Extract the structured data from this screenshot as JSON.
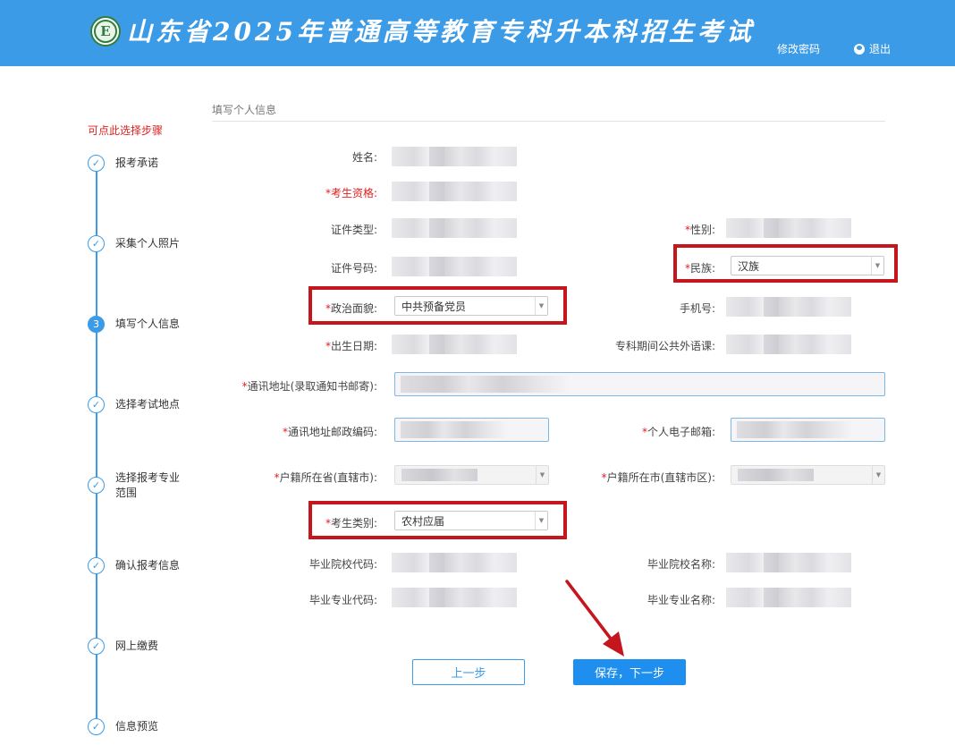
{
  "header": {
    "title": "山东省2025年普通高等教育专科升本科招生考试",
    "logo_text": "E",
    "change_password": "修改密码",
    "logout": "退出"
  },
  "sidebar": {
    "hint": "可点此选择步骤",
    "steps": [
      {
        "label": "报考承诺",
        "marker": "✓"
      },
      {
        "label": "采集个人照片",
        "marker": "✓"
      },
      {
        "label": "填写个人信息",
        "marker": "3"
      },
      {
        "label": "选择考试地点",
        "marker": "✓"
      },
      {
        "label": "选择报考专业范围",
        "marker": "✓"
      },
      {
        "label": "确认报考信息",
        "marker": "✓"
      },
      {
        "label": "网上缴费",
        "marker": "✓"
      },
      {
        "label": "信息预览",
        "marker": "✓"
      }
    ]
  },
  "form": {
    "section_title": "填写个人信息",
    "labels": {
      "name": "姓名:",
      "qualification": "考生资格:",
      "id_type": "证件类型:",
      "gender": "性别:",
      "id_number": "证件号码:",
      "ethnicity": "民族:",
      "political": "政治面貌:",
      "phone": "手机号:",
      "birth_date": "出生日期:",
      "foreign_lang": "专科期间公共外语课:",
      "address": "通讯地址(录取通知书邮寄):",
      "postcode": "通讯地址邮政编码:",
      "email": "个人电子邮箱:",
      "province": "户籍所在省(直辖市):",
      "city": "户籍所在市(直辖市区):",
      "category": "考生类别:",
      "school_code": "毕业院校代码:",
      "school_name": "毕业院校名称:",
      "major_code": "毕业专业代码:",
      "major_name": "毕业专业名称:"
    },
    "values": {
      "ethnicity": "汉族",
      "political": "中共预备党员",
      "category": "农村应届"
    },
    "required_mark": "*"
  },
  "buttons": {
    "prev": "上一步",
    "next": "保存，下一步"
  },
  "colors": {
    "header": "#3c9be6",
    "accent": "#1e8fee",
    "required": "#e02020",
    "highlight": "#c4161c"
  }
}
